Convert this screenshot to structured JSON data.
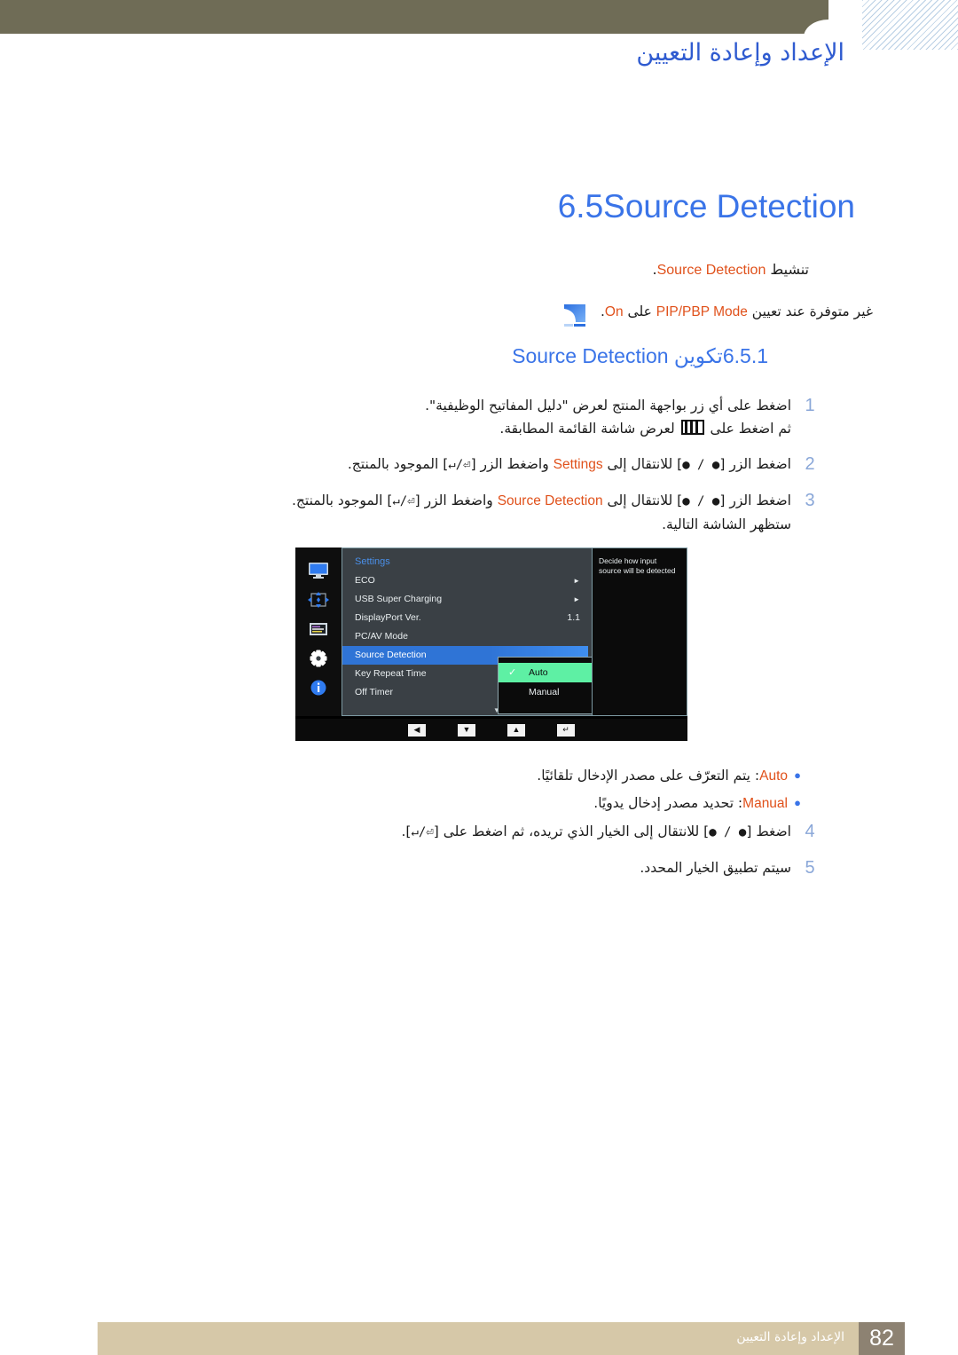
{
  "header": {
    "title": "الإعداد وإعادة التعيين"
  },
  "section": {
    "number": "6.5",
    "title": "Source Detection",
    "intro_prefix": "تنشيط ",
    "intro_term": "Source Detection",
    "intro_suffix": "."
  },
  "note": {
    "icon": "note-icon",
    "text_a": "غير متوفرة عند تعيين ",
    "term_a": "PIP/PBP Mode",
    "text_b": " على ",
    "term_b": "On",
    "text_c": "."
  },
  "subsection": {
    "number": "6.5.1",
    "title_ar": "تكوين ",
    "title_en": "Source Detection"
  },
  "steps": [
    {
      "num": "1",
      "line1_a": "اضغط على أي زر بواجهة المنتج لعرض \"دليل المفاتيح الوظيفية\".",
      "line2_a": "ثم اضغط على ",
      "line2_icon": "menu-icon",
      "line2_b": " لعرض شاشة القائمة المطابقة."
    },
    {
      "num": "2",
      "a": "اضغط الزر [",
      "btn1": "● / ●",
      "b": "] للانتقال إلى ",
      "term": "Settings",
      "c": " واضغط الزر [",
      "btn2": "⏎/↵",
      "d": "] الموجود بالمنتج."
    },
    {
      "num": "3",
      "a": "اضغط الزر [",
      "btn1": "● / ●",
      "b": "] للانتقال إلى ",
      "term": "Source Detection",
      "c": " واضغط الزر [",
      "btn2": "⏎/↵",
      "d": "] الموجود بالمنتج.",
      "line2": "ستظهر الشاشة التالية."
    }
  ],
  "steps_after": [
    {
      "num": "4",
      "a": "اضغط [",
      "btn1": "● / ●",
      "b": "] للانتقال إلى الخيار الذي تريده، ثم اضغط على [",
      "btn2": "⏎/↵",
      "c": "]."
    },
    {
      "num": "5",
      "a": "سيتم تطبيق الخيار المحدد."
    }
  ],
  "osd": {
    "menu_title": "Settings",
    "sidebar_icons": [
      "monitor-icon",
      "position-arrows-icon",
      "onscreen-display-icon",
      "gear-icon",
      "info-icon"
    ],
    "items": [
      {
        "label": "ECO",
        "arrow": "►",
        "value": ""
      },
      {
        "label": "USB Super Charging",
        "arrow": "►",
        "value": ""
      },
      {
        "label": "DisplayPort Ver.",
        "arrow": "",
        "value": "1.1"
      },
      {
        "label": "PC/AV Mode",
        "arrow": "",
        "value": ""
      },
      {
        "label": "Source Detection",
        "arrow": "",
        "value": "",
        "selected": true
      },
      {
        "label": "Key Repeat Time",
        "arrow": "",
        "value": ""
      },
      {
        "label": "Off Timer",
        "arrow": "",
        "value": ""
      }
    ],
    "scroll_down_glyph": "▼",
    "submenu": [
      {
        "label": "Auto",
        "checked": true
      },
      {
        "label": "Manual",
        "checked": false
      }
    ],
    "checkmark": "✓",
    "info_text": "Decide how input source will be detected",
    "navbar": [
      {
        "name": "nav-left-icon",
        "glyph": "◀"
      },
      {
        "name": "nav-down-icon",
        "glyph": "▼"
      },
      {
        "name": "nav-up-icon",
        "glyph": "▲"
      },
      {
        "name": "nav-enter-icon",
        "glyph": "↵"
      }
    ]
  },
  "bullets": [
    {
      "dot": "●",
      "term": "Auto",
      "text": ": يتم التعرّف على مصدر الإدخال تلقائيًا."
    },
    {
      "dot": "●",
      "term": "Manual",
      "text": ": تحديد مصدر إدخال يدويًا."
    }
  ],
  "footer": {
    "text": "الإعداد وإعادة التعيين",
    "page": "82"
  },
  "colors": {
    "header_band": "#6f6c56",
    "heading_blue": "#3a74e8",
    "term_orange": "#e0511b",
    "footer_band": "#d6c8a8",
    "page_box": "#8d8272",
    "osd_highlight": "#2f74d6",
    "osd_submenu_active": "#5ef0a4"
  }
}
